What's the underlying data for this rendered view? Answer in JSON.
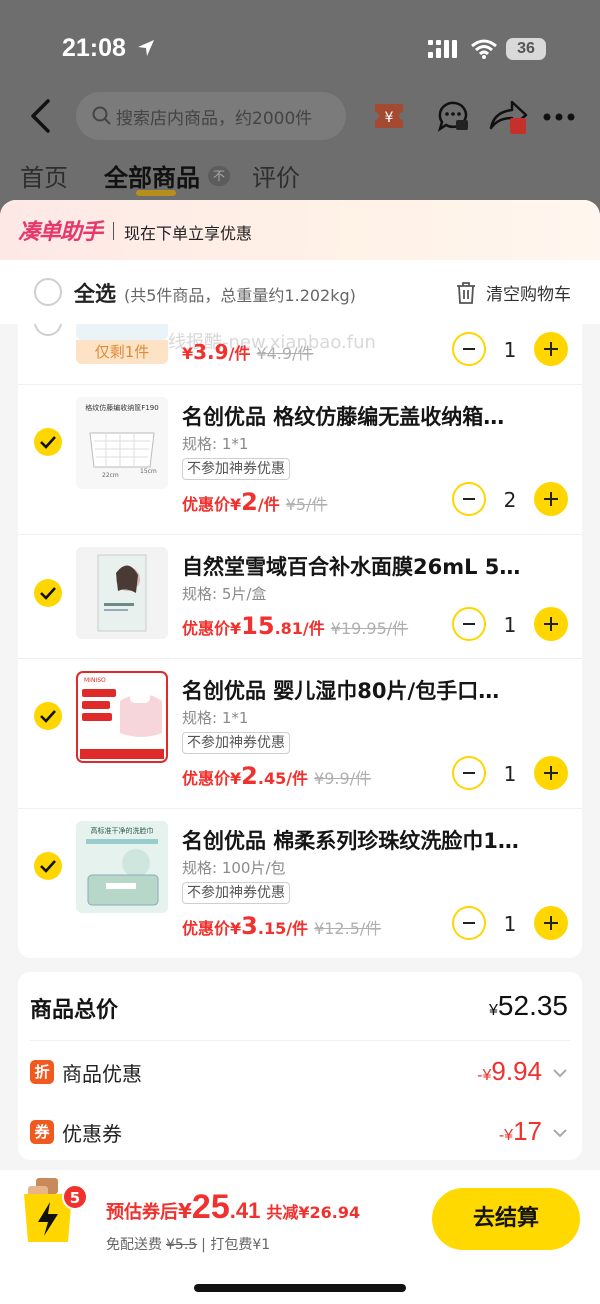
{
  "status": {
    "time": "21:08",
    "battery": "36"
  },
  "nav": {
    "search_placeholder": "搜索店内商品，约2000件"
  },
  "tabs": [
    {
      "label": "首页"
    },
    {
      "label": "全部商品"
    },
    {
      "label": "评价"
    }
  ],
  "tab_sort_glyph": "不",
  "helper": {
    "logo": "凑单助手",
    "text": "现在下单立享优惠"
  },
  "cart_header": {
    "select_all": "全选",
    "summary": "(共5件商品，总重量约1.202kg)",
    "clear": "清空购物车"
  },
  "partial_item": {
    "badge": "仅剩1件",
    "price_yen": "¥",
    "price_big": "3.9",
    "unit": "/件",
    "original": "¥4.9/件",
    "qty": "1"
  },
  "watermark": "线报酷-new.xianbao.fun",
  "items": [
    {
      "title": "名创优品 格纹仿藤编无盖收纳箱…",
      "spec": "规格: 1*1",
      "tag": "不参加神券优惠",
      "price_label": "优惠价",
      "yen": "¥",
      "price_big": "2",
      "price_dec": "",
      "unit": "/件",
      "original": "¥5/件",
      "qty": "2",
      "thumb_text": "格纹仿藤编收纳筐F190"
    },
    {
      "title": "自然堂雪域百合补水面膜26mL 5…",
      "spec": "规格: 5片/盒",
      "tag": "",
      "price_label": "优惠价",
      "yen": "¥",
      "price_big": "15",
      "price_dec": ".81",
      "unit": "/件",
      "original": "¥19.95/件",
      "qty": "1",
      "thumb_text": ""
    },
    {
      "title": "名创优品 婴儿湿巾80片/包手口…",
      "spec": "规格: 1*1",
      "tag": "不参加神券优惠",
      "price_label": "优惠价",
      "yen": "¥",
      "price_big": "2",
      "price_dec": ".45",
      "unit": "/件",
      "original": "¥9.9/件",
      "qty": "1",
      "thumb_text": "MINISO"
    },
    {
      "title": "名创优品 棉柔系列珍珠纹洗脸巾1…",
      "spec": "规格: 100片/包",
      "tag": "不参加神券优惠",
      "price_label": "优惠价",
      "yen": "¥",
      "price_big": "3",
      "price_dec": ".15",
      "unit": "/件",
      "original": "¥12.5/件",
      "qty": "1",
      "thumb_text": "高标准干净的洗脸巾"
    }
  ],
  "summary": {
    "total_label": "商品总价",
    "total_yen": "¥",
    "total": "52.35",
    "discount_badge": "折",
    "discount_label": "商品优惠",
    "discount_sign": "-¥",
    "discount": "9.94",
    "coupon_badge": "券",
    "coupon_label": "优惠券",
    "coupon_sign": "-¥",
    "coupon": "17"
  },
  "bottom": {
    "cart_count": "5",
    "est_label": "预估券后",
    "est_yen": "¥",
    "est_big": "25",
    "est_dec": ".41",
    "save": "共减¥26.94",
    "ship_free": "免配送费",
    "ship_original": "¥5.5",
    "pack_fee": "打包费¥1",
    "checkout": "去结算"
  },
  "colors": {
    "accent": "#ffd600",
    "price_red": "#f0312d",
    "overlay": "#6e6e6e"
  }
}
